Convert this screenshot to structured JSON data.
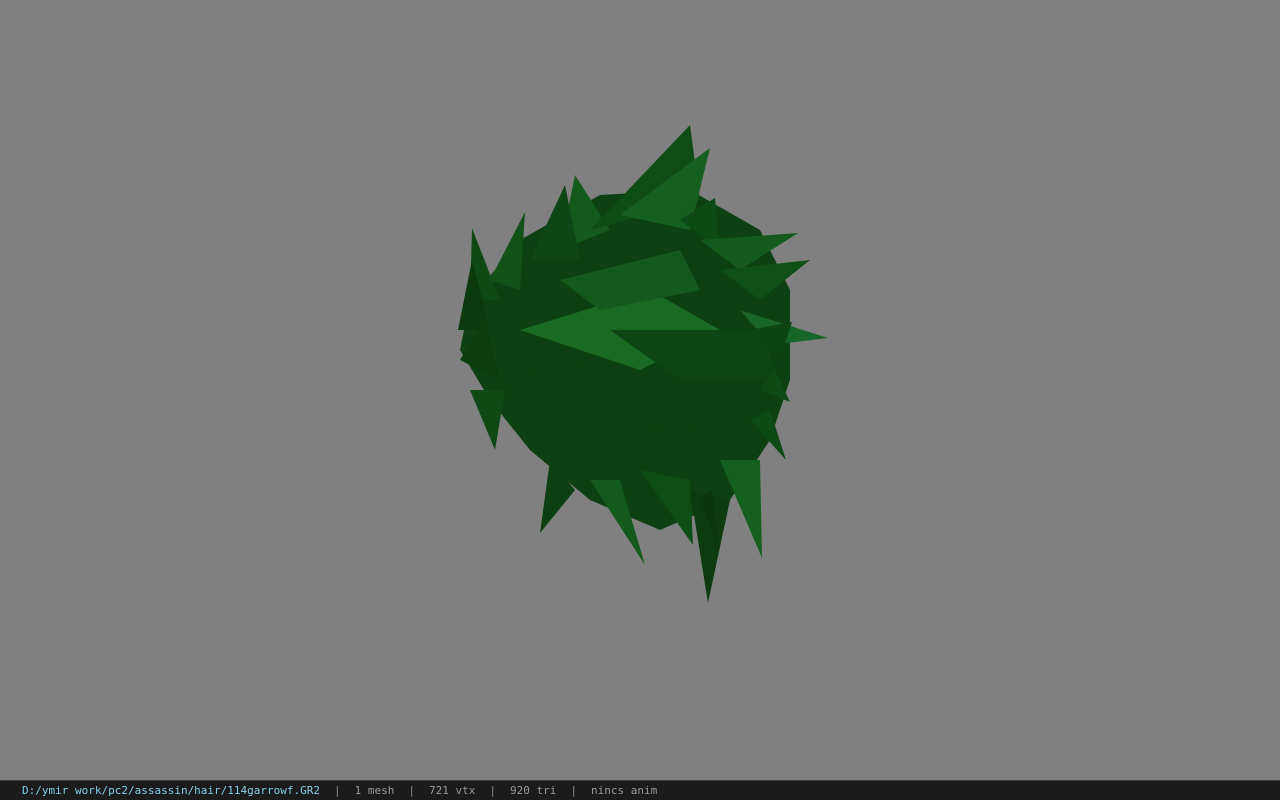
{
  "viewer": {
    "background_color": "#808080",
    "model_color": "#0f4a14",
    "model_description_icon": "hair-mesh-model"
  },
  "status": {
    "path": "D:/ymir work/pc2/assassin/hair/114garrowf.GR2",
    "separator": "|",
    "mesh": "1 mesh",
    "vertices": "721 vtx",
    "triangles": "920 tri",
    "anim": "nincs anim"
  }
}
